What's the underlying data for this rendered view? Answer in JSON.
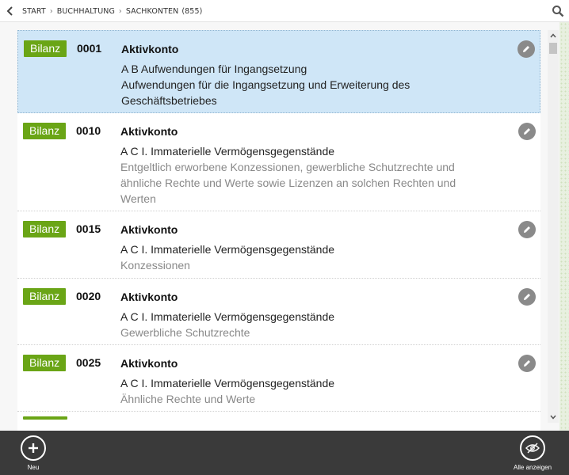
{
  "breadcrumb": {
    "items": [
      "START",
      "BUCHHALTUNG",
      "SACHKONTEN"
    ],
    "count": "(855)"
  },
  "rows": [
    {
      "badge": "Bilanz",
      "code": "0001",
      "title": "Aktivkonto",
      "line1": "A B Aufwendungen für Ingangsetzung",
      "line2": "Aufwendungen für die Ingangsetzung und Erweiterung des Geschäftsbetriebes",
      "selected": true
    },
    {
      "badge": "Bilanz",
      "code": "0010",
      "title": "Aktivkonto",
      "line1": "A C I. Immaterielle Vermögensgegenstände",
      "line2": "Entgeltlich erworbene Konzessionen, gewerbliche Schutzrechte und ähnliche Rechte und Werte sowie Lizenzen an solchen Rechten und Werten",
      "selected": false
    },
    {
      "badge": "Bilanz",
      "code": "0015",
      "title": "Aktivkonto",
      "line1": "A C I. Immaterielle Vermögensgegenstände",
      "line2": "Konzessionen",
      "selected": false
    },
    {
      "badge": "Bilanz",
      "code": "0020",
      "title": "Aktivkonto",
      "line1": "A C I. Immaterielle Vermögensgegenstände",
      "line2": "Gewerbliche Schutzrechte",
      "selected": false
    },
    {
      "badge": "Bilanz",
      "code": "0025",
      "title": "Aktivkonto",
      "line1": "A C I. Immaterielle Vermögensgegenstände",
      "line2": "Ähnliche Rechte und Werte",
      "selected": false
    }
  ],
  "bottombar": {
    "new_label": "Neu",
    "show_all_label": "Alle anzeigen"
  },
  "colors": {
    "badge": "#6aa516",
    "selected_row": "#cfe6f7",
    "bottombar": "#3a3a3a"
  },
  "icons": {
    "back": "chevron-left-icon",
    "search": "search-icon",
    "edit": "pencil-icon",
    "new": "plus-icon",
    "show_all": "eye-off-icon"
  }
}
